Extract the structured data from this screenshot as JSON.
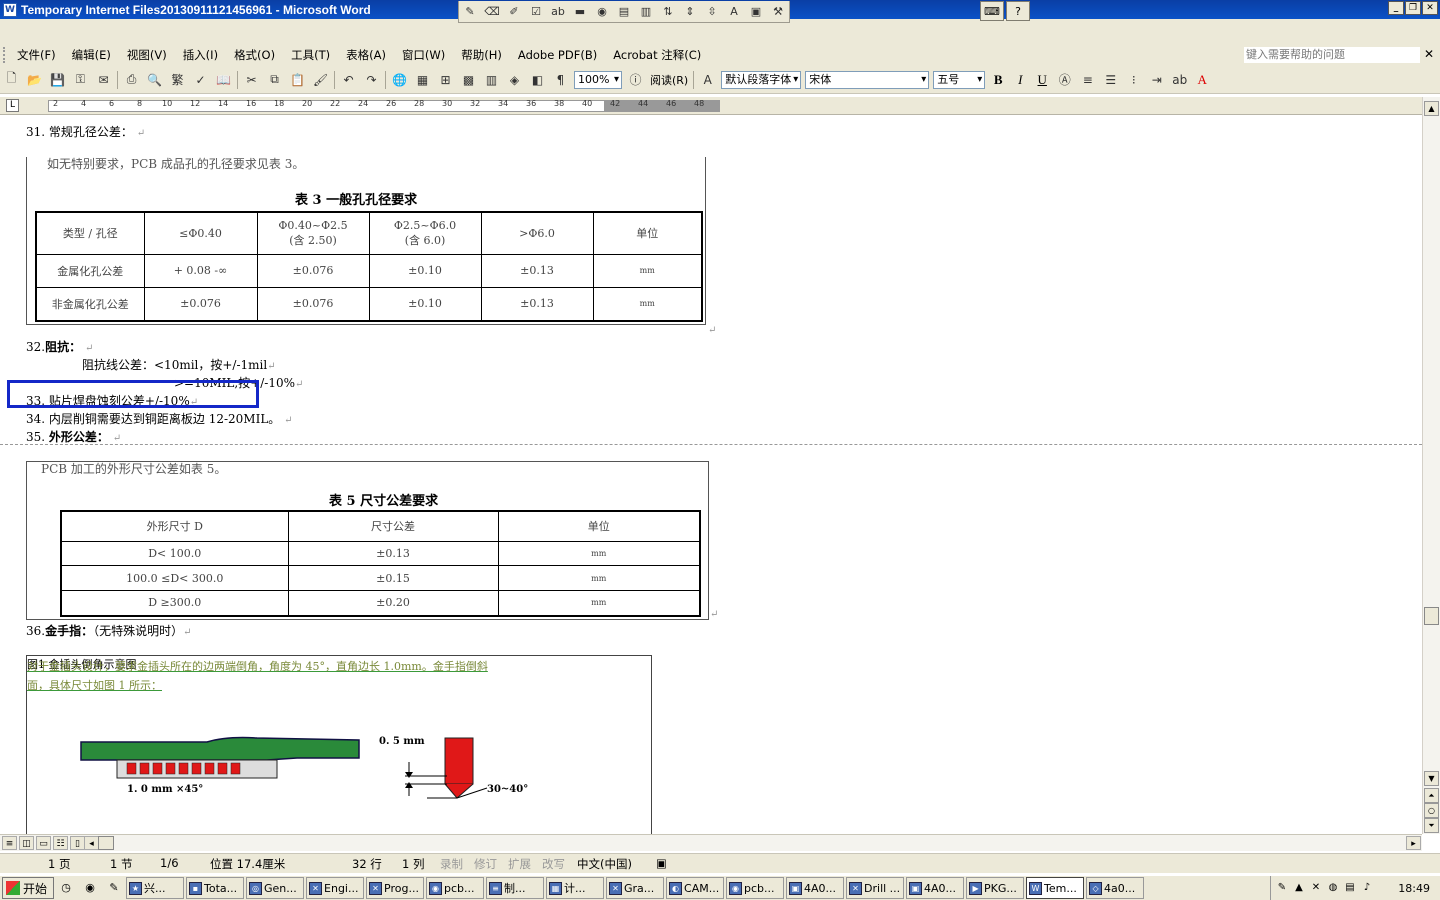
{
  "window": {
    "title": "Temporary Internet Files20130911121456961 - Microsoft Word",
    "help_placeholder": "键入需要帮助的问题"
  },
  "menu": [
    "文件(F)",
    "编辑(E)",
    "视图(V)",
    "插入(I)",
    "格式(O)",
    "工具(T)",
    "表格(A)",
    "窗口(W)",
    "帮助(H)",
    "Adobe PDF(B)",
    "Acrobat 注释(C)"
  ],
  "toolbar": {
    "zoom": "100%",
    "read_label": "阅读(R)",
    "style": "默认段落字体",
    "font": "宋体",
    "size": "五号",
    "bold": "B",
    "italic": "I",
    "underline": "U",
    "font_color": "A"
  },
  "ruler_ticks": [
    "2",
    "4",
    "6",
    "8",
    "10",
    "12",
    "14",
    "16",
    "18",
    "20",
    "22",
    "24",
    "26",
    "28",
    "30",
    "32",
    "34",
    "36",
    "38",
    "40",
    "42",
    "44",
    "46",
    "48"
  ],
  "document": {
    "item31": "31.  常规孔径公差：",
    "table3_intro": "如无特别要求，PCB 成品孔的孔径要求见表 3。",
    "table3_title": "表 3    一般孔孔径要求",
    "table3": {
      "headers": [
        "类型 / 孔径",
        "≤Φ0.40",
        "Φ0.40~Φ2.5",
        "Φ2.5~Φ6.0",
        ">Φ6.0",
        "单位"
      ],
      "headers_sub": [
        "",
        "",
        "(含 2.50)",
        "(含 6.0)",
        "",
        ""
      ],
      "rows": [
        [
          "金属化孔公差",
          "+ 0.08  -∞",
          "±0.076",
          "±0.10",
          "±0.13",
          "mm"
        ],
        [
          "非金属化孔公差",
          "±0.076",
          "±0.076",
          "±0.10",
          "±0.13",
          "mm"
        ]
      ]
    },
    "item32_num": "32.",
    "item32_label": "阻抗：",
    "impedance_line1": "阻抗线公差：<10mil，按+/-1mil",
    "impedance_line2": ">=10MIL,按+/-10%",
    "item33": "33.  贴片焊盘蚀刻公差+/-10%",
    "item34": "34.  内层削铜需要达到铜距离板边 12-20MIL。",
    "item35_num": "35.",
    "item35_label": "外形公差：",
    "table5_intro": "PCB 加工的外形尺寸公差如表 5。",
    "table5_title": "表 5    尺寸公差要求",
    "table5": {
      "headers": [
        "外形尺寸 D",
        "尺寸公差",
        "单位"
      ],
      "rows": [
        [
          "D< 100.0",
          "±0.13",
          "mm"
        ],
        [
          "100.0 ≤D< 300.0",
          "±0.15",
          "mm"
        ],
        [
          "D ≥300.0",
          "±0.20",
          "mm"
        ]
      ]
    },
    "item36_num": "36.",
    "item36_label": "金手指：",
    "item36_note": "（无特殊说明时）",
    "gold_text1": "对于金插头设计，要求金插头所在的边两端倒角，角度为 45°，直角边长 1.0mm。金手指倒斜",
    "gold_text2": "面，具体尺寸如图 1 所示：",
    "dim_left": "1. 0  mm  ×45°",
    "dim_top": "0. 5   mm",
    "dim_angle": "30~40°",
    "figure_caption": "图1   金插头倒角示意图"
  },
  "status": {
    "page": "1 页",
    "section": "1 节",
    "pages": "1/6",
    "position": "位置 17.4厘米",
    "line": "32 行",
    "column": "1 列",
    "rec": "录制",
    "trk": "修订",
    "ext": "扩展",
    "ovr": "改写",
    "language": "中文(中国)"
  },
  "taskbar": {
    "start": "开始",
    "tasks": [
      "兴...",
      "Tota...",
      "Gen...",
      "Engi...",
      "Prog...",
      "pcb...",
      "制...",
      "计...",
      "Gra...",
      "CAM...",
      "pcb...",
      "4A0...",
      "Drill ...",
      "4A0...",
      "PKG...",
      "Tem...",
      "4a0..."
    ],
    "clock": "18:49"
  },
  "colors": {
    "titlebar": "#0b52c7",
    "highlight": "#1428c8",
    "pcb_green": "#2a8a3a",
    "gold_red": "#e01818"
  }
}
